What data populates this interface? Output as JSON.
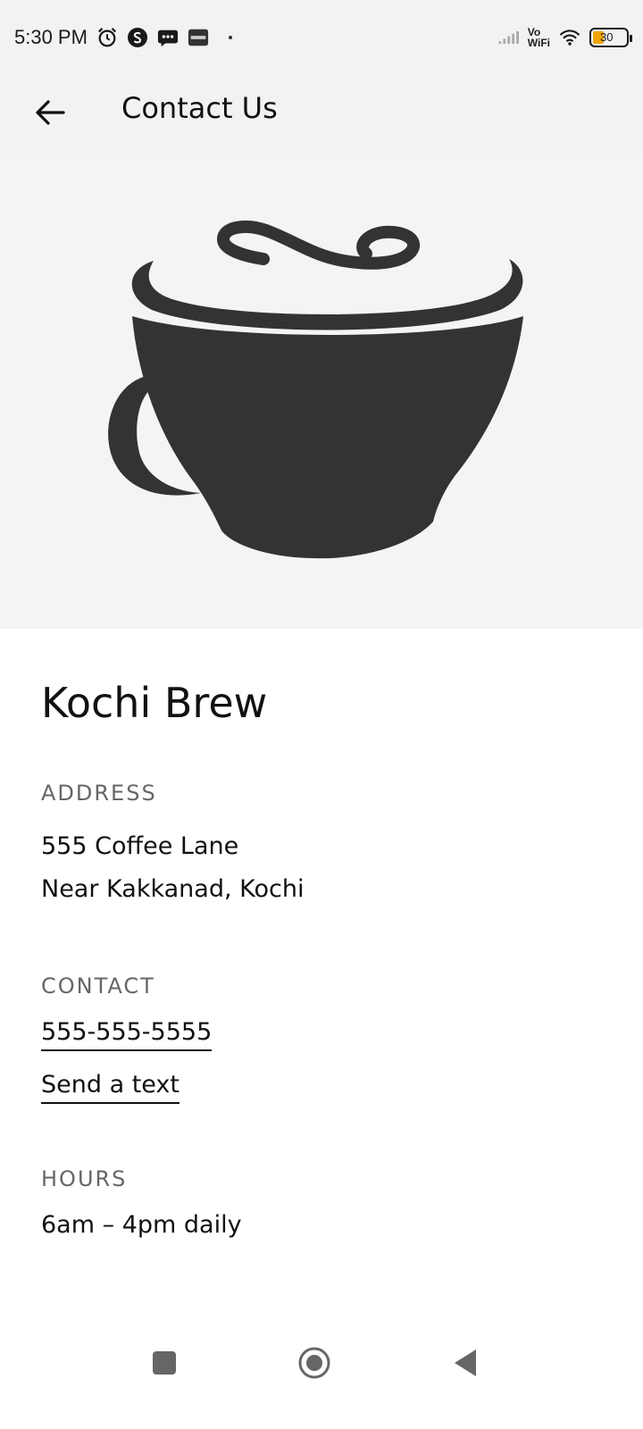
{
  "status_bar": {
    "time": "5:30 PM",
    "icons": [
      "alarm-icon",
      "s-app-icon",
      "message-icon",
      "paytm-icon"
    ],
    "vo_top": "Vo",
    "vo_bottom": "WiFi",
    "battery_level": "30",
    "battery_accent": "#f0a400"
  },
  "app_bar": {
    "title": "Contact Us",
    "back_icon": "arrow-left-icon"
  },
  "hero": {
    "image": "coffee-cup-logo",
    "background": "#f4f4f4",
    "cup_color": "#333333"
  },
  "shop": {
    "name": "Kochi Brew"
  },
  "address": {
    "label": "ADDRESS",
    "line1": "555 Coffee Lane",
    "line2": "Near Kakkanad, Kochi"
  },
  "contact": {
    "label": "CONTACT",
    "phone": "555-555-5555",
    "text_link": "Send a text"
  },
  "hours": {
    "label": "HOURS",
    "value": "6am – 4pm daily"
  },
  "nav_bar": {
    "icons": [
      "recent-apps-icon",
      "home-icon",
      "back-triangle-icon"
    ]
  }
}
